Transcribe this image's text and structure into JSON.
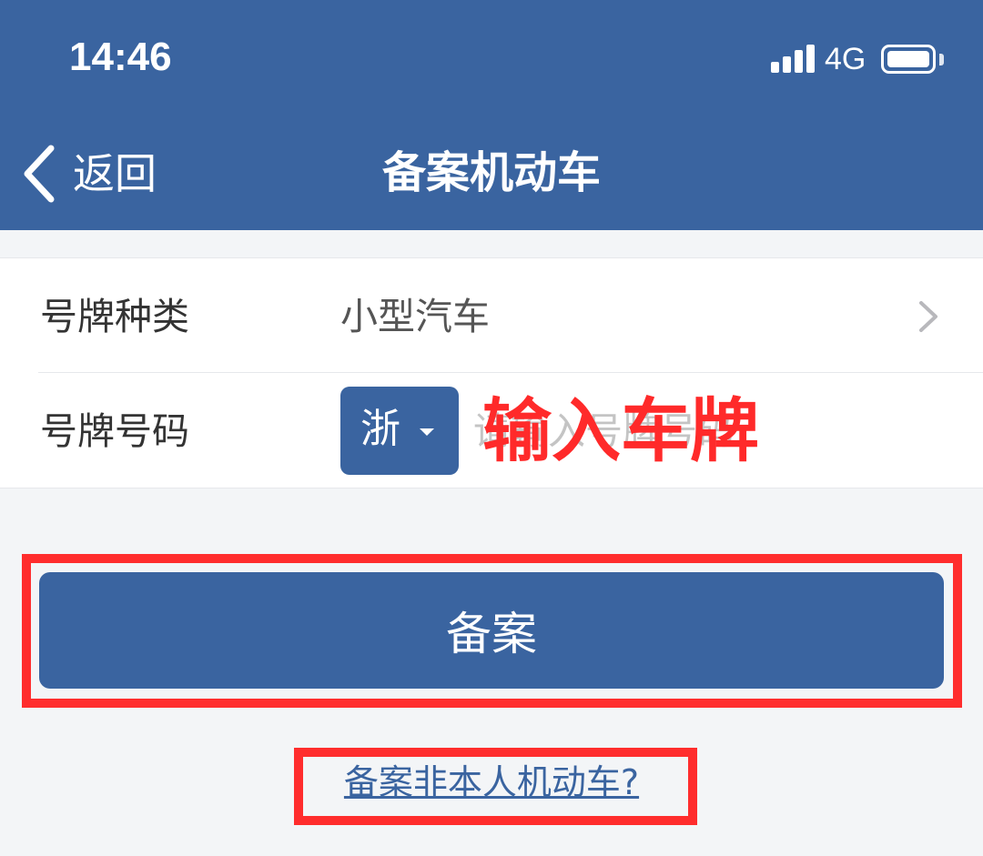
{
  "status_bar": {
    "time": "14:46",
    "network": "4G",
    "signal_icon": "signal-bars-icon",
    "battery_icon": "battery-icon"
  },
  "nav": {
    "back_label": "返回",
    "back_icon": "chevron-left-icon",
    "title": "备案机动车"
  },
  "form": {
    "plate_type": {
      "label": "号牌种类",
      "value": "小型汽车",
      "icon": "chevron-right-icon"
    },
    "plate_number": {
      "label": "号牌号码",
      "province": "浙",
      "province_icon": "caret-down-icon",
      "placeholder": "请输入号牌号码",
      "value": ""
    }
  },
  "submit": {
    "label": "备案"
  },
  "other_link": {
    "label": "备案非本人机动车?"
  },
  "annotations": {
    "plate_hint": "输入车牌"
  },
  "colors": {
    "brand": "#3a64a0",
    "background": "#f3f5f7",
    "annotation": "#ff2d2d"
  }
}
